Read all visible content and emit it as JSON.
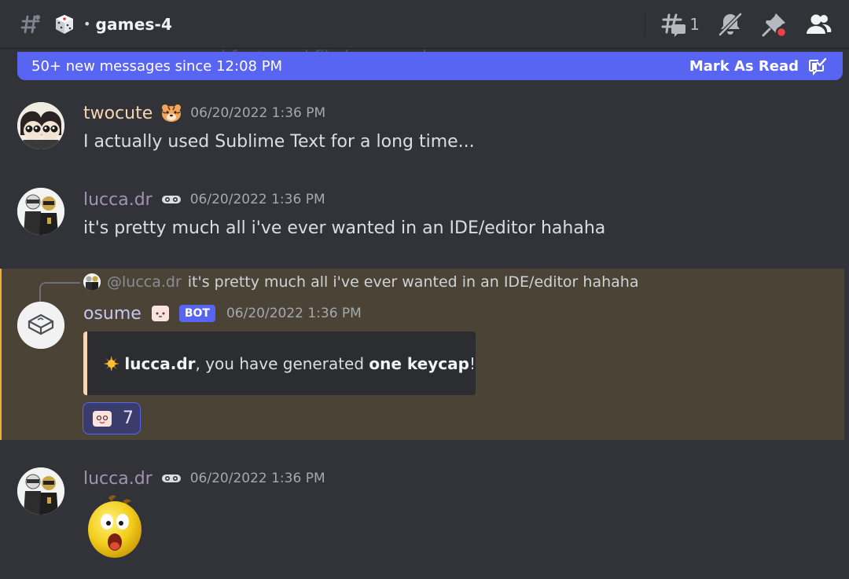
{
  "channel": {
    "name": "games-4",
    "separator": "•",
    "thread_count": "1"
  },
  "new_messages_bar": {
    "text": "50+ new messages since 12:08 PM",
    "mark_read_label": "Mark As Read",
    "ghost_text": "...s and fonts and file icons packs"
  },
  "messages": [
    {
      "username": "twocute",
      "username_color": "#f5d6ae",
      "timestamp": "06/20/2022 1:36 PM",
      "content": "I actually used Sublime Text for a long time..."
    },
    {
      "username": "lucca.dr",
      "username_color": "#a393b2",
      "timestamp": "06/20/2022 1:36 PM",
      "content": "it's pretty much all i've ever wanted in an IDE/editor hahaha"
    },
    {
      "username": "osume",
      "username_color": "#c9c4f5",
      "bot_tag": "BOT",
      "timestamp": "06/20/2022 1:36 PM",
      "reply": {
        "user": "@lucca.dr",
        "text": "it's pretty much all i've ever wanted in an IDE/editor hahaha"
      },
      "embed": {
        "bold_user": "lucca.dr",
        "middle": ", you have generated ",
        "bold_item": "one keycap",
        "end": "!"
      },
      "reaction": {
        "count": "7"
      }
    },
    {
      "username": "lucca.dr",
      "username_color": "#a393b2",
      "timestamp": "06/20/2022 1:36 PM",
      "content": ""
    }
  ],
  "colors": {
    "background": "#313338",
    "accent": "#5865f2",
    "mention_highlight": "#4b4436",
    "mention_border": "#f0b132"
  }
}
